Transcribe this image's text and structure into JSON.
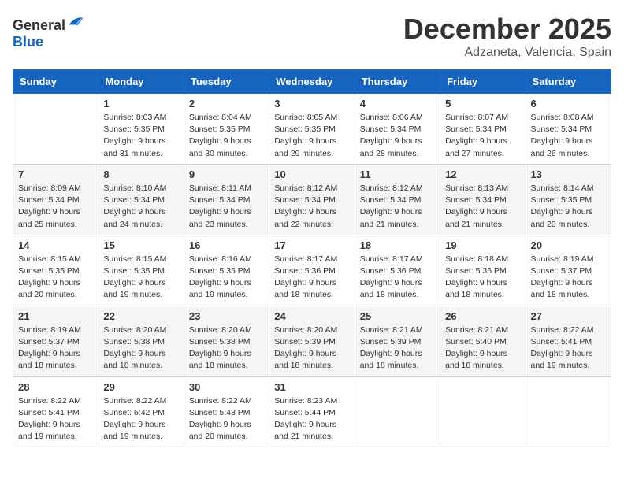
{
  "logo": {
    "general": "General",
    "blue": "Blue"
  },
  "title": "December 2025",
  "location": "Adzaneta, Valencia, Spain",
  "days_of_week": [
    "Sunday",
    "Monday",
    "Tuesday",
    "Wednesday",
    "Thursday",
    "Friday",
    "Saturday"
  ],
  "weeks": [
    [
      {
        "day": "",
        "sunrise": "",
        "sunset": "",
        "daylight": ""
      },
      {
        "day": "1",
        "sunrise": "Sunrise: 8:03 AM",
        "sunset": "Sunset: 5:35 PM",
        "daylight": "Daylight: 9 hours and 31 minutes."
      },
      {
        "day": "2",
        "sunrise": "Sunrise: 8:04 AM",
        "sunset": "Sunset: 5:35 PM",
        "daylight": "Daylight: 9 hours and 30 minutes."
      },
      {
        "day": "3",
        "sunrise": "Sunrise: 8:05 AM",
        "sunset": "Sunset: 5:35 PM",
        "daylight": "Daylight: 9 hours and 29 minutes."
      },
      {
        "day": "4",
        "sunrise": "Sunrise: 8:06 AM",
        "sunset": "Sunset: 5:34 PM",
        "daylight": "Daylight: 9 hours and 28 minutes."
      },
      {
        "day": "5",
        "sunrise": "Sunrise: 8:07 AM",
        "sunset": "Sunset: 5:34 PM",
        "daylight": "Daylight: 9 hours and 27 minutes."
      },
      {
        "day": "6",
        "sunrise": "Sunrise: 8:08 AM",
        "sunset": "Sunset: 5:34 PM",
        "daylight": "Daylight: 9 hours and 26 minutes."
      }
    ],
    [
      {
        "day": "7",
        "sunrise": "Sunrise: 8:09 AM",
        "sunset": "Sunset: 5:34 PM",
        "daylight": "Daylight: 9 hours and 25 minutes."
      },
      {
        "day": "8",
        "sunrise": "Sunrise: 8:10 AM",
        "sunset": "Sunset: 5:34 PM",
        "daylight": "Daylight: 9 hours and 24 minutes."
      },
      {
        "day": "9",
        "sunrise": "Sunrise: 8:11 AM",
        "sunset": "Sunset: 5:34 PM",
        "daylight": "Daylight: 9 hours and 23 minutes."
      },
      {
        "day": "10",
        "sunrise": "Sunrise: 8:12 AM",
        "sunset": "Sunset: 5:34 PM",
        "daylight": "Daylight: 9 hours and 22 minutes."
      },
      {
        "day": "11",
        "sunrise": "Sunrise: 8:12 AM",
        "sunset": "Sunset: 5:34 PM",
        "daylight": "Daylight: 9 hours and 21 minutes."
      },
      {
        "day": "12",
        "sunrise": "Sunrise: 8:13 AM",
        "sunset": "Sunset: 5:34 PM",
        "daylight": "Daylight: 9 hours and 21 minutes."
      },
      {
        "day": "13",
        "sunrise": "Sunrise: 8:14 AM",
        "sunset": "Sunset: 5:35 PM",
        "daylight": "Daylight: 9 hours and 20 minutes."
      }
    ],
    [
      {
        "day": "14",
        "sunrise": "Sunrise: 8:15 AM",
        "sunset": "Sunset: 5:35 PM",
        "daylight": "Daylight: 9 hours and 20 minutes."
      },
      {
        "day": "15",
        "sunrise": "Sunrise: 8:15 AM",
        "sunset": "Sunset: 5:35 PM",
        "daylight": "Daylight: 9 hours and 19 minutes."
      },
      {
        "day": "16",
        "sunrise": "Sunrise: 8:16 AM",
        "sunset": "Sunset: 5:35 PM",
        "daylight": "Daylight: 9 hours and 19 minutes."
      },
      {
        "day": "17",
        "sunrise": "Sunrise: 8:17 AM",
        "sunset": "Sunset: 5:36 PM",
        "daylight": "Daylight: 9 hours and 18 minutes."
      },
      {
        "day": "18",
        "sunrise": "Sunrise: 8:17 AM",
        "sunset": "Sunset: 5:36 PM",
        "daylight": "Daylight: 9 hours and 18 minutes."
      },
      {
        "day": "19",
        "sunrise": "Sunrise: 8:18 AM",
        "sunset": "Sunset: 5:36 PM",
        "daylight": "Daylight: 9 hours and 18 minutes."
      },
      {
        "day": "20",
        "sunrise": "Sunrise: 8:19 AM",
        "sunset": "Sunset: 5:37 PM",
        "daylight": "Daylight: 9 hours and 18 minutes."
      }
    ],
    [
      {
        "day": "21",
        "sunrise": "Sunrise: 8:19 AM",
        "sunset": "Sunset: 5:37 PM",
        "daylight": "Daylight: 9 hours and 18 minutes."
      },
      {
        "day": "22",
        "sunrise": "Sunrise: 8:20 AM",
        "sunset": "Sunset: 5:38 PM",
        "daylight": "Daylight: 9 hours and 18 minutes."
      },
      {
        "day": "23",
        "sunrise": "Sunrise: 8:20 AM",
        "sunset": "Sunset: 5:38 PM",
        "daylight": "Daylight: 9 hours and 18 minutes."
      },
      {
        "day": "24",
        "sunrise": "Sunrise: 8:20 AM",
        "sunset": "Sunset: 5:39 PM",
        "daylight": "Daylight: 9 hours and 18 minutes."
      },
      {
        "day": "25",
        "sunrise": "Sunrise: 8:21 AM",
        "sunset": "Sunset: 5:39 PM",
        "daylight": "Daylight: 9 hours and 18 minutes."
      },
      {
        "day": "26",
        "sunrise": "Sunrise: 8:21 AM",
        "sunset": "Sunset: 5:40 PM",
        "daylight": "Daylight: 9 hours and 18 minutes."
      },
      {
        "day": "27",
        "sunrise": "Sunrise: 8:22 AM",
        "sunset": "Sunset: 5:41 PM",
        "daylight": "Daylight: 9 hours and 19 minutes."
      }
    ],
    [
      {
        "day": "28",
        "sunrise": "Sunrise: 8:22 AM",
        "sunset": "Sunset: 5:41 PM",
        "daylight": "Daylight: 9 hours and 19 minutes."
      },
      {
        "day": "29",
        "sunrise": "Sunrise: 8:22 AM",
        "sunset": "Sunset: 5:42 PM",
        "daylight": "Daylight: 9 hours and 19 minutes."
      },
      {
        "day": "30",
        "sunrise": "Sunrise: 8:22 AM",
        "sunset": "Sunset: 5:43 PM",
        "daylight": "Daylight: 9 hours and 20 minutes."
      },
      {
        "day": "31",
        "sunrise": "Sunrise: 8:23 AM",
        "sunset": "Sunset: 5:44 PM",
        "daylight": "Daylight: 9 hours and 21 minutes."
      },
      {
        "day": "",
        "sunrise": "",
        "sunset": "",
        "daylight": ""
      },
      {
        "day": "",
        "sunrise": "",
        "sunset": "",
        "daylight": ""
      },
      {
        "day": "",
        "sunrise": "",
        "sunset": "",
        "daylight": ""
      }
    ]
  ]
}
